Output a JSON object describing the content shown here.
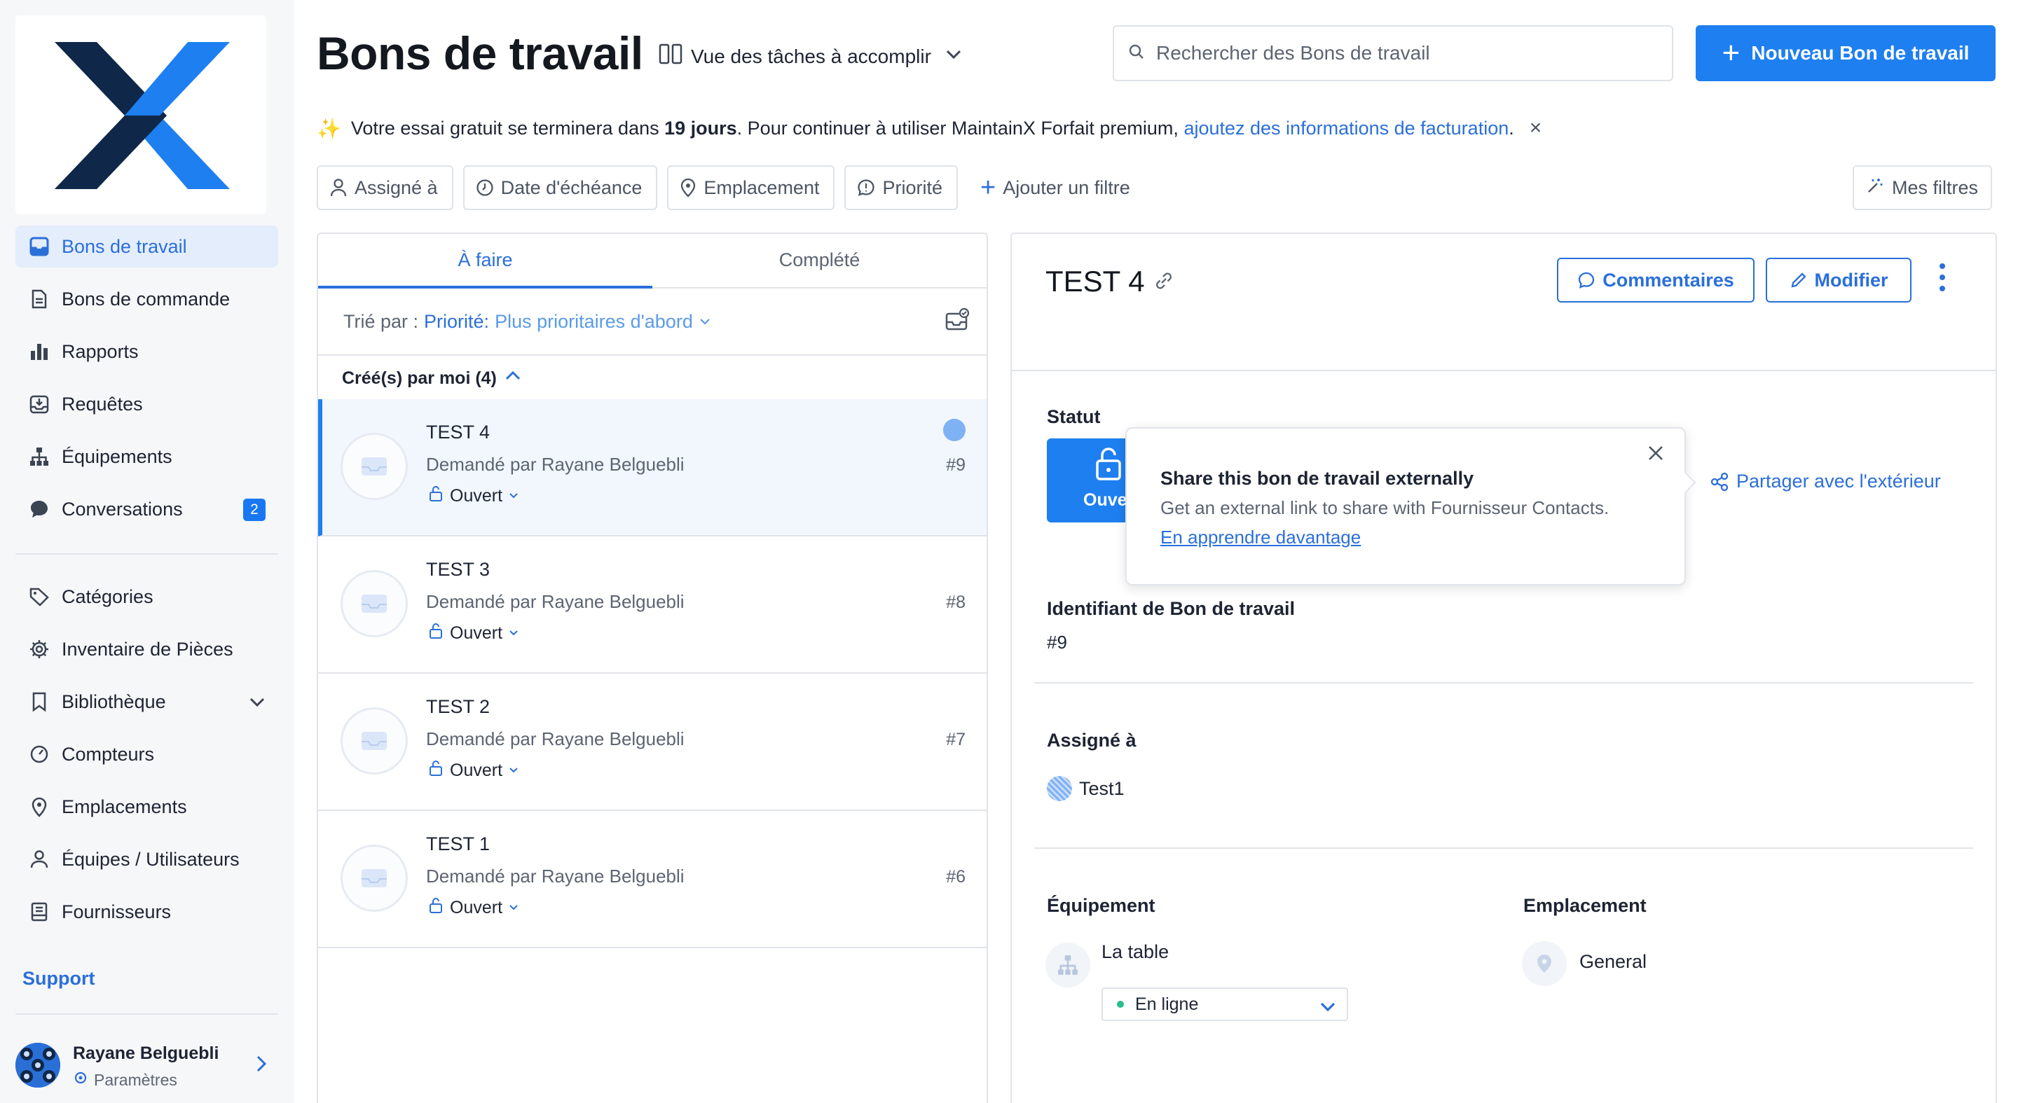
{
  "colors": {
    "accent": "#1e7ff0",
    "link": "#2b6fd9",
    "sidebar_bg": "#f6f7f9",
    "badge": "#1877f2",
    "online": "#25c08a"
  },
  "sidebar": {
    "items": [
      {
        "label": "Bons de travail",
        "icon": "inbox-icon",
        "active": true
      },
      {
        "label": "Bons de commande",
        "icon": "document-icon"
      },
      {
        "label": "Rapports",
        "icon": "bar-chart-icon"
      },
      {
        "label": "Requêtes",
        "icon": "inbox-download-icon"
      },
      {
        "label": "Équipements",
        "icon": "hierarchy-icon"
      },
      {
        "label": "Conversations",
        "icon": "chat-icon",
        "badge": "2"
      }
    ],
    "items2": [
      {
        "label": "Catégories",
        "icon": "tag-icon"
      },
      {
        "label": "Inventaire de Pièces",
        "icon": "gear-icon"
      },
      {
        "label": "Bibliothèque",
        "icon": "bookmark-icon"
      },
      {
        "label": "Compteurs",
        "icon": "gauge-icon"
      },
      {
        "label": "Emplacements",
        "icon": "location-icon"
      },
      {
        "label": "Équipes / Utilisateurs",
        "icon": "users-icon"
      },
      {
        "label": "Fournisseurs",
        "icon": "vendor-icon"
      }
    ],
    "support": "Support",
    "profile": {
      "name": "Rayane Belguebli",
      "settings": "Paramètres"
    }
  },
  "header": {
    "title": "Bons de travail",
    "view_label": "Vue des tâches à accomplir",
    "search_placeholder": "Rechercher des Bons de travail",
    "new_button": "Nouveau Bon de travail"
  },
  "banner": {
    "text_before": "Votre essai gratuit se terminera dans",
    "days": "19 jours",
    "text_after": ". Pour continuer à utiliser MaintainX Forfait premium,",
    "link": "ajoutez des informations de facturation",
    "end": "."
  },
  "filters": {
    "items": [
      "Assigné à",
      "Date d'échéance",
      "Emplacement",
      "Priorité"
    ],
    "add": "Ajouter un filtre",
    "my_filters": "Mes filtres"
  },
  "list": {
    "tabs": [
      "À faire",
      "Complété"
    ],
    "sort_prefix": "Trié par :",
    "sort_field": "Priorité:",
    "sort_value": "Plus prioritaires d'abord",
    "group_label": "Créé(s) par moi (4)",
    "cards": [
      {
        "title": "TEST 4",
        "requested": "Demandé par Rayane Belguebli",
        "status": "Ouvert",
        "number": "#9"
      },
      {
        "title": "TEST 3",
        "requested": "Demandé par Rayane Belguebli",
        "status": "Ouvert",
        "number": "#8"
      },
      {
        "title": "TEST 2",
        "requested": "Demandé par Rayane Belguebli",
        "status": "Ouvert",
        "number": "#7"
      },
      {
        "title": "TEST 1",
        "requested": "Demandé par Rayane Belguebli",
        "status": "Ouvert",
        "number": "#6"
      }
    ]
  },
  "detail": {
    "title": "TEST 4",
    "comments_button": "Commentaires",
    "edit_button": "Modifier",
    "status_label": "Statut",
    "status_value": "Ouvert",
    "share_link": "Partager avec l'extérieur",
    "id_label": "Identifiant de Bon de travail",
    "id_value": "#9",
    "assigned_label": "Assigné à",
    "assignee": "Test1",
    "asset_label": "Équipement",
    "asset_value": "La table",
    "asset_state": "En ligne",
    "location_label": "Emplacement",
    "location_value": "General"
  },
  "popover": {
    "title": "Share this bon de travail externally",
    "body": "Get an external link to share with Fournisseur Contacts.",
    "link": "En apprendre davantage"
  }
}
